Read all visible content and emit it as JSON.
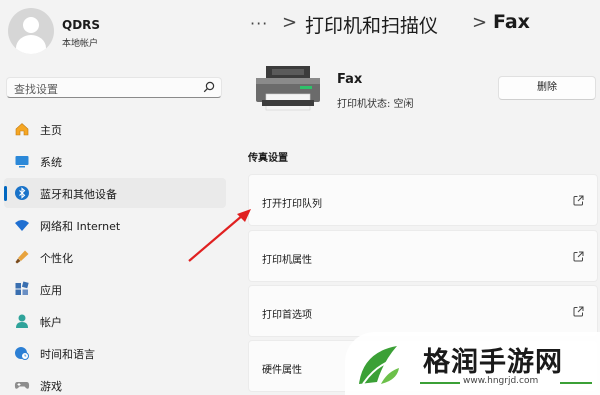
{
  "user": {
    "name": "QDRS",
    "account_type": "本地帐户"
  },
  "search": {
    "placeholder": "查找设置"
  },
  "nav": {
    "items": [
      {
        "label": "主页",
        "icon": "home-icon"
      },
      {
        "label": "系统",
        "icon": "display-icon"
      },
      {
        "label": "蓝牙和其他设备",
        "icon": "bluetooth-icon",
        "active": true
      },
      {
        "label": "网络和 Internet",
        "icon": "wifi-icon"
      },
      {
        "label": "个性化",
        "icon": "brush-icon"
      },
      {
        "label": "应用",
        "icon": "apps-icon"
      },
      {
        "label": "帐户",
        "icon": "person-icon"
      },
      {
        "label": "时间和语言",
        "icon": "globe-clock-icon"
      },
      {
        "label": "游戏",
        "icon": "gamepad-icon"
      }
    ]
  },
  "breadcrumb": {
    "more": "···",
    "parent": "打印机和扫描仪",
    "current": "Fax",
    "separator": ">"
  },
  "device": {
    "name": "Fax",
    "status": "打印机状态:  空闲",
    "delete_label": "删除"
  },
  "section": {
    "title": "传真设置"
  },
  "cards": [
    {
      "label": "打开打印队列"
    },
    {
      "label": "打印机属性"
    },
    {
      "label": "打印首选项"
    },
    {
      "label": "硬件属性"
    }
  ],
  "watermark": {
    "title": "格润手游网",
    "url": "www.hngrjd.com"
  },
  "colors": {
    "accent": "#0067c0",
    "arrow": "#e02020",
    "brand_green": "#3ba036"
  }
}
